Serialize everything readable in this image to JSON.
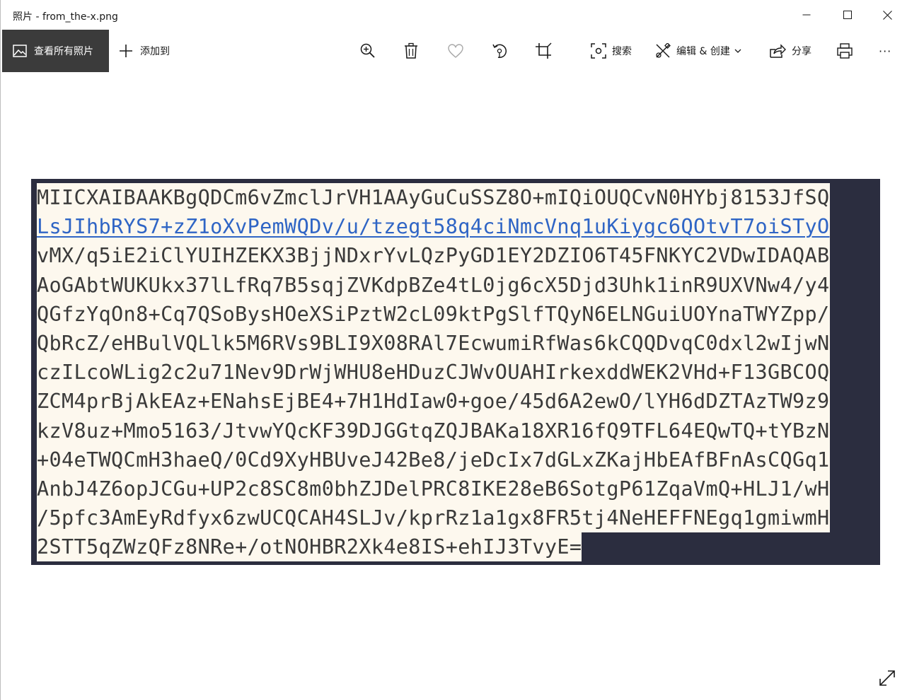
{
  "window": {
    "title": "照片 - from_the-x.png"
  },
  "toolbar": {
    "view_all_label": "查看所有照片",
    "add_to_label": "添加到",
    "search_label": "搜索",
    "edit_create_label": "编辑 & 创建",
    "share_label": "分享",
    "more_label": "···",
    "icons": {
      "view_all": "image-icon",
      "add_to": "plus-icon",
      "zoom": "zoom-in-icon",
      "delete": "trash-icon",
      "favorite": "heart-icon",
      "rotate": "rotate-icon",
      "crop": "crop-icon",
      "search": "visual-search-icon",
      "edit": "edit-create-icon",
      "share": "share-icon",
      "print": "print-icon"
    }
  },
  "image_content": {
    "background_color": "#2b2d3f",
    "text_background_color": "#fdf8ee",
    "link_color": "#2f65c5",
    "lines": [
      "MIICXAIBAAKBgQDCm6vZmclJrVH1AAyGuCuSSZ8O+mIQiOUQCvN0HYbj8153JfSQ",
      "LsJIhbRYS7+zZ1oXvPemWQDv/u/tzegt58q4ciNmcVnq1uKiygc6QOtvT7oiSTyO",
      "vMX/q5iE2iClYUIHZEKX3BjjNDxrYvLQzPyGD1EY2DZIO6T45FNKYC2VDwIDAQAB",
      "AoGAbtWUKUkx37lLfRq7B5sqjZVKdpBZe4tL0jg6cX5Djd3Uhk1inR9UXVNw4/y4",
      "QGfzYqOn8+Cq7QSoBysHOeXSiPztW2cL09ktPgSlfTQyN6ELNGuiUOYnaTWYZpp/",
      "QbRcZ/eHBulVQLlk5M6RVs9BLI9X08RAl7EcwumiRfWas6kCQQDvqC0dxl2wIjwN",
      "czILcoWLig2c2u71Nev9DrWjWHU8eHDuzCJWvOUAHIrkexddWEK2VHd+F13GBCOQ",
      "ZCM4prBjAkEAz+ENahsEjBE4+7H1HdIaw0+goe/45d6A2ewO/lYH6dDZTAzTW9z9",
      "kzV8uz+Mmo5163/JtvwYQcKF39DJGGtqZQJBAKa18XR16fQ9TFL64EQwTQ+tYBzN",
      "+04eTWQCmH3haeQ/0Cd9XyHBUveJ42Be8/jeDcIx7dGLxZKajHbEAfBFnAsCQGq1",
      "AnbJ4Z6opJCGu+UP2c8SC8m0bhZJDelPRC8IKE28eB6SotgP61ZqaVmQ+HLJ1/wH",
      "/5pfc3AmEyRdfyx6zwUCQCAH4SLJv/kprRz1a1gx8FR5tj4NeHEFFNEgq1gmiwmH",
      "2STT5qZWzQFz8NRe+/otNOHBR2Xk4e8IS+ehIJ3TvyE="
    ]
  }
}
